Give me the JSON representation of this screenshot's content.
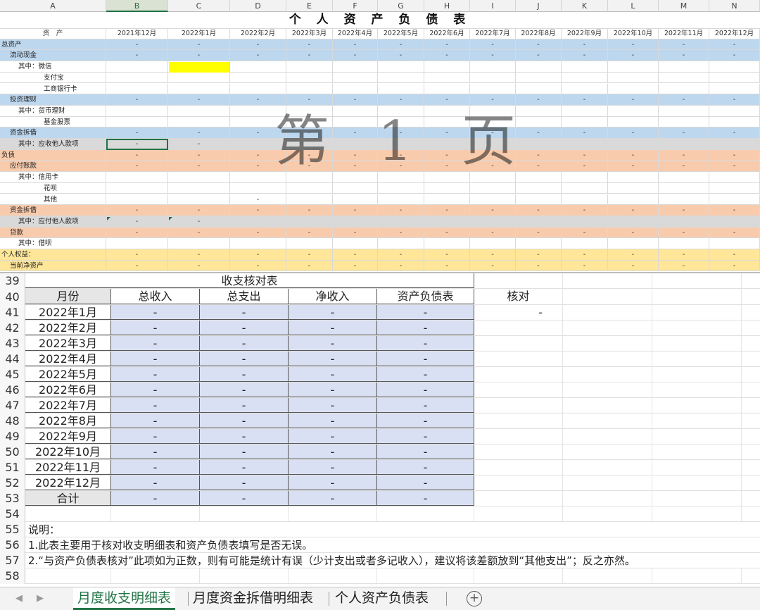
{
  "top_sheet": {
    "columns": [
      "A",
      "B",
      "C",
      "D",
      "E",
      "F",
      "G",
      "H",
      "I",
      "J",
      "K",
      "L",
      "M",
      "N"
    ],
    "title": "个 人 资 产 负 债 表",
    "watermark": "第 1 页",
    "header_label": "资　产",
    "months": [
      "2021年12月",
      "2022年1月",
      "2022年2月",
      "2022年3月",
      "2022年4月",
      "2022年5月",
      "2022年6月",
      "2022年7月",
      "2022年8月",
      "2022年9月",
      "2022年10月",
      "2022年11月",
      "2022年12月"
    ],
    "rows": [
      {
        "label": "总资产",
        "style": "blue",
        "indent": 0,
        "dash": "all"
      },
      {
        "label": "流动现金",
        "style": "blue",
        "indent": 1,
        "dash": "all"
      },
      {
        "label": "其中：微信",
        "style": "",
        "indent": 2,
        "dash": "none"
      },
      {
        "label": "支付宝",
        "style": "",
        "indent": 3,
        "dash": "none"
      },
      {
        "label": "工商银行卡",
        "style": "",
        "indent": 3,
        "dash": "none"
      },
      {
        "label": "投资理财",
        "style": "blue",
        "indent": 1,
        "dash": "all"
      },
      {
        "label": "其中：货币理财",
        "style": "",
        "indent": 2,
        "dash": "none"
      },
      {
        "label": "基金股票",
        "style": "",
        "indent": 3,
        "dash": "none"
      },
      {
        "label": "资金拆借",
        "style": "blue",
        "indent": 1,
        "dash": "all"
      },
      {
        "label": "其中：应收他人款项",
        "style": "grey",
        "indent": 2,
        "dash": "two"
      },
      {
        "label": "负债",
        "style": "orange",
        "indent": 0,
        "dash": "all"
      },
      {
        "label": "应付账款",
        "style": "orange",
        "indent": 1,
        "dash": "all"
      },
      {
        "label": "其中：信用卡",
        "style": "",
        "indent": 2,
        "dash": "none"
      },
      {
        "label": "花呗",
        "style": "",
        "indent": 3,
        "dash": "none"
      },
      {
        "label": "其他",
        "style": "",
        "indent": 3,
        "dash": "d"
      },
      {
        "label": "资金拆借",
        "style": "orange",
        "indent": 1,
        "dash": "all"
      },
      {
        "label": "其中：应付他人款项",
        "style": "grey",
        "indent": 2,
        "dash": "two"
      },
      {
        "label": "贷款",
        "style": "orange",
        "indent": 1,
        "dash": "all"
      },
      {
        "label": "其中：借呗",
        "style": "",
        "indent": 2,
        "dash": "none"
      },
      {
        "label": "个人权益：",
        "style": "gold",
        "indent": 0,
        "dash": "all"
      },
      {
        "label": "当前净资产",
        "style": "gold",
        "indent": 1,
        "dash": "all"
      }
    ],
    "dash_value": "-"
  },
  "bottom_sheet": {
    "table_title": "收支核对表",
    "headers": [
      "月份",
      "总收入",
      "总支出",
      "净收入",
      "资产负债表"
    ],
    "check_header": "核对",
    "check_value": "-",
    "dash_value": "-",
    "months": [
      "2022年1月",
      "2022年2月",
      "2022年3月",
      "2022年4月",
      "2022年5月",
      "2022年6月",
      "2022年7月",
      "2022年8月",
      "2022年9月",
      "2022年10月",
      "2022年11月",
      "2022年12月",
      "合计"
    ],
    "row_numbers": [
      "39",
      "40",
      "41",
      "42",
      "43",
      "44",
      "45",
      "46",
      "47",
      "48",
      "49",
      "50",
      "51",
      "52",
      "53",
      "54",
      "55",
      "56",
      "57",
      "58"
    ],
    "notes": [
      "说明：",
      "1.此表主要用于核对收支明细表和资产负债表填写是否无误。",
      "2.“与资产负债表核对”此项如为正数，则有可能是统计有误（少计支出或者多记收入），建议将该差额放到“其他支出”；反之亦然。"
    ]
  },
  "tabs": {
    "items": [
      "月度收支明细表",
      "月度资金拆借明细表",
      "个人资产负债表"
    ],
    "active_index": 0,
    "add_label": "+"
  },
  "colors": {
    "accent": "#217346",
    "blue_fill": "#bdd7ee",
    "orange_fill": "#f8cbad",
    "gold_fill": "#ffe699",
    "lavender_fill": "#dae0f3",
    "highlight_yellow": "#ffff00"
  }
}
